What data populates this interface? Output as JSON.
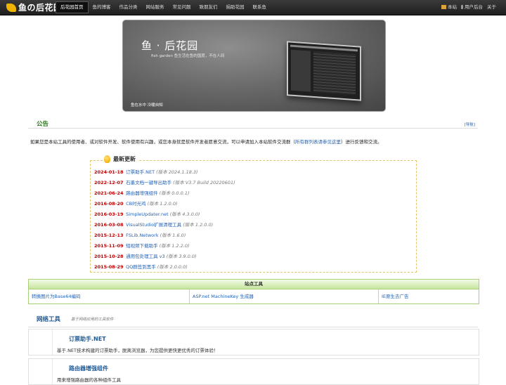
{
  "nav": {
    "logo": "鱼の后花园",
    "items": [
      "后花园首页",
      "鱼的博客",
      "作品分类",
      "网站服务",
      "常见问题",
      "致朋友们",
      "捐助花园",
      "联系鱼"
    ],
    "right": [
      "本站",
      "用户后台",
      "关于"
    ]
  },
  "banner": {
    "title": "鱼 · 后花园",
    "subtitle": "fish garden 鱼生活在鱼的国度，不在人间",
    "footer": "鱼在水中 冷暖自知"
  },
  "notice": {
    "title": "公告",
    "link": "[导航]",
    "text_before": "如果您是本站工具的使用者、或对软件开发、软件使用有兴趣，或您本身就是软件开发者愿意交流，可以申请加入本站软件交流群（",
    "text_link": "所有群列表请参见这里",
    "text_after": "）进行反馈和交流。"
  },
  "updates": {
    "title": "最新更新",
    "items": [
      {
        "date": "2024-01-18",
        "name": "订票助手.NET",
        "version": "(版本 2024.1.18.3)"
      },
      {
        "date": "2022-12-07",
        "name": "石墨文档一键导出助手",
        "version": "(版本 V3.7 Build 20220601)"
      },
      {
        "date": "2021-06-24",
        "name": "路由器增强组件",
        "version": "(版本 0.0.0.1)"
      },
      {
        "date": "2016-08-20",
        "name": "CB时光鸡",
        "version": "(版本 1.2.0.0)"
      },
      {
        "date": "2016-03-19",
        "name": "SimpleUpdater.net",
        "version": "(版本 4.3.0.0)"
      },
      {
        "date": "2016-03-08",
        "name": "VisualStudio扩展清理工具",
        "version": "(版本 1.2.0.0)"
      },
      {
        "date": "2015-12-13",
        "name": "FSLib.Network",
        "version": "(版本 1.6.0)"
      },
      {
        "date": "2015-11-09",
        "name": "短视频下载助手",
        "version": "(版本 1.2.2.0)"
      },
      {
        "date": "2015-10-28",
        "name": "通用包处理工具 v3",
        "version": "(版本 3.9.0.0)"
      },
      {
        "date": "2015-08-29",
        "name": "QQ群签到黑手",
        "version": "(版本 2.0.0.0)"
      }
    ]
  },
  "site_tools": {
    "title": "站点工具",
    "items": [
      "转换图片为Base64编码",
      "ASP.net MachineKey 生成器",
      "IE原生去广告"
    ]
  },
  "network_tools": {
    "title": "网络工具",
    "subtitle": "基于网络应用的工具软件",
    "items": [
      {
        "name": "订票助手.NET",
        "desc": "基于.NET技术构建的订票助手，脱离浏览器，为您提供更快更优秀的订票体验！"
      },
      {
        "name": "路由器增强组件",
        "desc": "用来增强路由器的各种组件工具"
      }
    ]
  }
}
